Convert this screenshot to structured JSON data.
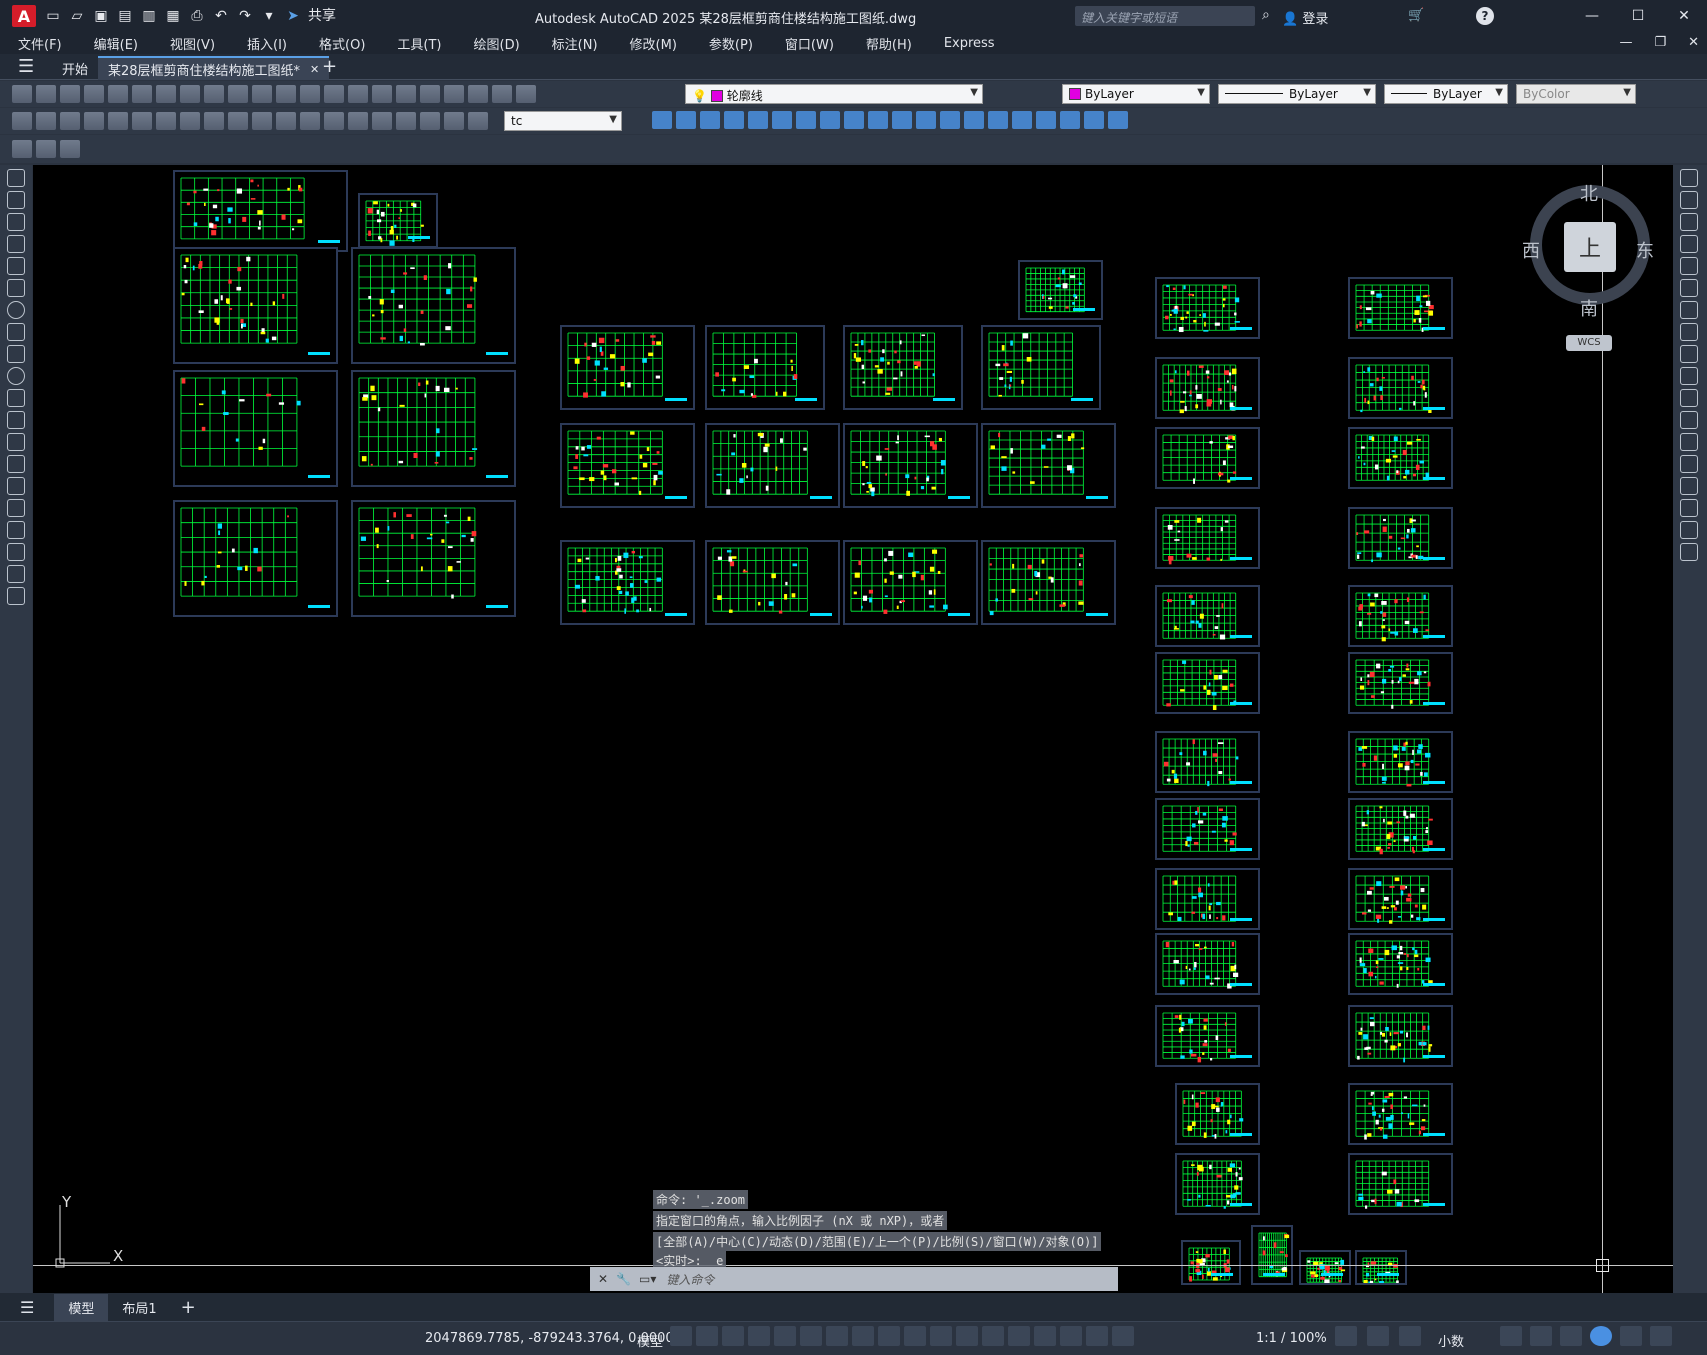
{
  "app": {
    "title": "Autodesk AutoCAD 2025    某28层框剪商住楼结构施工图纸.dwg",
    "logo_letter": "A",
    "share_label": "共享",
    "search_placeholder": "键入关键字或短语",
    "login_label": "登录"
  },
  "menu": [
    "文件(F)",
    "编辑(E)",
    "视图(V)",
    "插入(I)",
    "格式(O)",
    "工具(T)",
    "绘图(D)",
    "标注(N)",
    "修改(M)",
    "参数(P)",
    "窗口(W)",
    "帮助(H)",
    "Express"
  ],
  "tabs": {
    "start": "开始",
    "document": "某28层框剪商住楼结构施工图纸*",
    "close": "✕",
    "add": "+"
  },
  "toolbar": {
    "layer_name": "轮廓线",
    "layer_color": "#e000e0",
    "color_value": "ByLayer",
    "linetype_value": "ByLayer",
    "lineweight_value": "ByLayer",
    "plotstyle_value": "ByColor",
    "textstyle_value": "tc"
  },
  "viewcube": {
    "north": "北",
    "south": "南",
    "east": "东",
    "west": "西",
    "face": "上",
    "wcs": "WCS"
  },
  "ucs": {
    "x_label": "X",
    "y_label": "Y"
  },
  "command": {
    "history": [
      "命令: '_.zoom",
      "指定窗口的角点，输入比例因子 (nX 或 nXP)，或者",
      "[全部(A)/中心(C)/动态(D)/范围(E)/上一个(P)/比例(S)/窗口(W)/对象(O)]",
      "<实时>: _e"
    ],
    "placeholder": "键入命令"
  },
  "layout_tabs": [
    "模型",
    "布局1"
  ],
  "status": {
    "coordinates": "2047869.7785, -879243.3764, 0.0000",
    "space": "模型",
    "annotation_scale": "1:1 / 100%",
    "units": "小数"
  },
  "colors": {
    "canvas_bg": "#000000",
    "ui_bg": "#2b3340",
    "drawing_green": "#00ff3c",
    "drawing_red": "#ff3030",
    "drawing_cyan": "#00e0ff",
    "sheet_border": "#2c3a58"
  }
}
